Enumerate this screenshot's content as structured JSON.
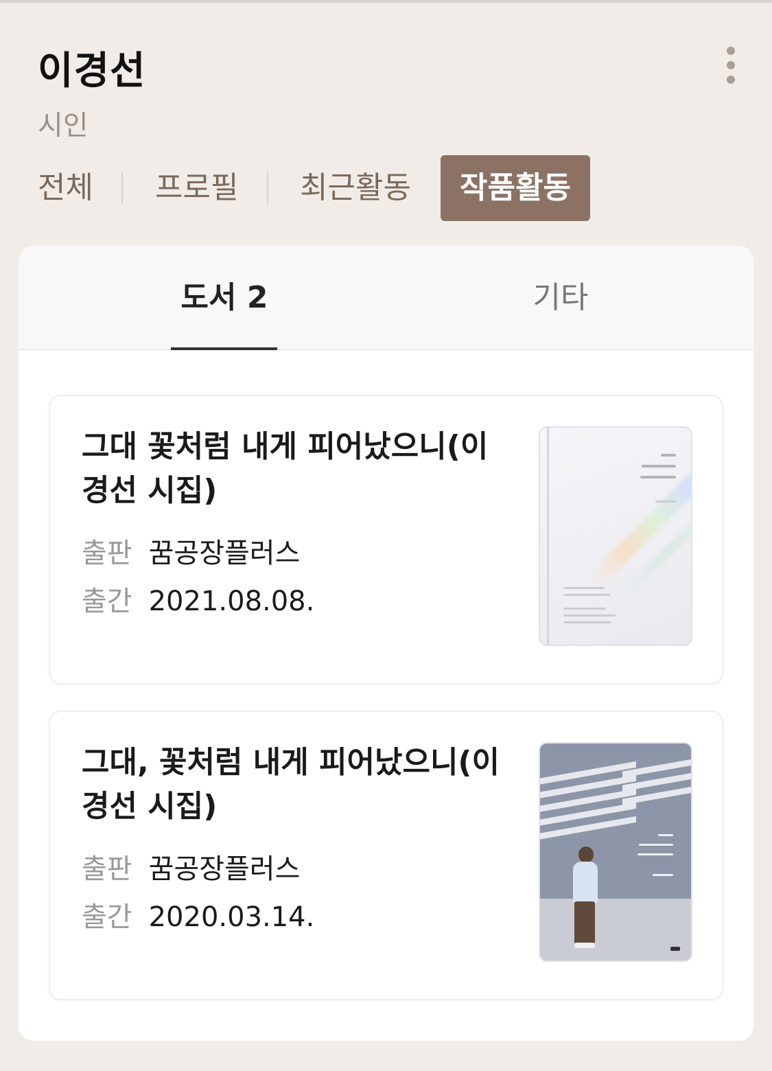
{
  "profile": {
    "name": "이경선",
    "role": "시인"
  },
  "filter_tabs": [
    {
      "label": "전체",
      "active": false
    },
    {
      "label": "프로필",
      "active": false
    },
    {
      "label": "최근활동",
      "active": false
    },
    {
      "label": "작품활동",
      "active": true
    }
  ],
  "more_icon": "vertical-ellipsis-icon",
  "sub_tabs": {
    "books": "도서 2",
    "etc": "기타"
  },
  "books": [
    {
      "title": "그대 꽃처럼 내게 피어났으니(이경선 시집)",
      "publisher_label": "출판",
      "publisher": "꿈공장플러스",
      "date_label": "출간",
      "date": "2021.08.08."
    },
    {
      "title": "그대, 꽃처럼 내게 피어났으니(이경선 시집)",
      "publisher_label": "출판",
      "publisher": "꿈공장플러스",
      "date_label": "출간",
      "date": "2020.03.14."
    }
  ],
  "colors": {
    "background": "#f1ece8",
    "active_tab": "#8b7264",
    "tab_text": "#7b6a5c"
  }
}
